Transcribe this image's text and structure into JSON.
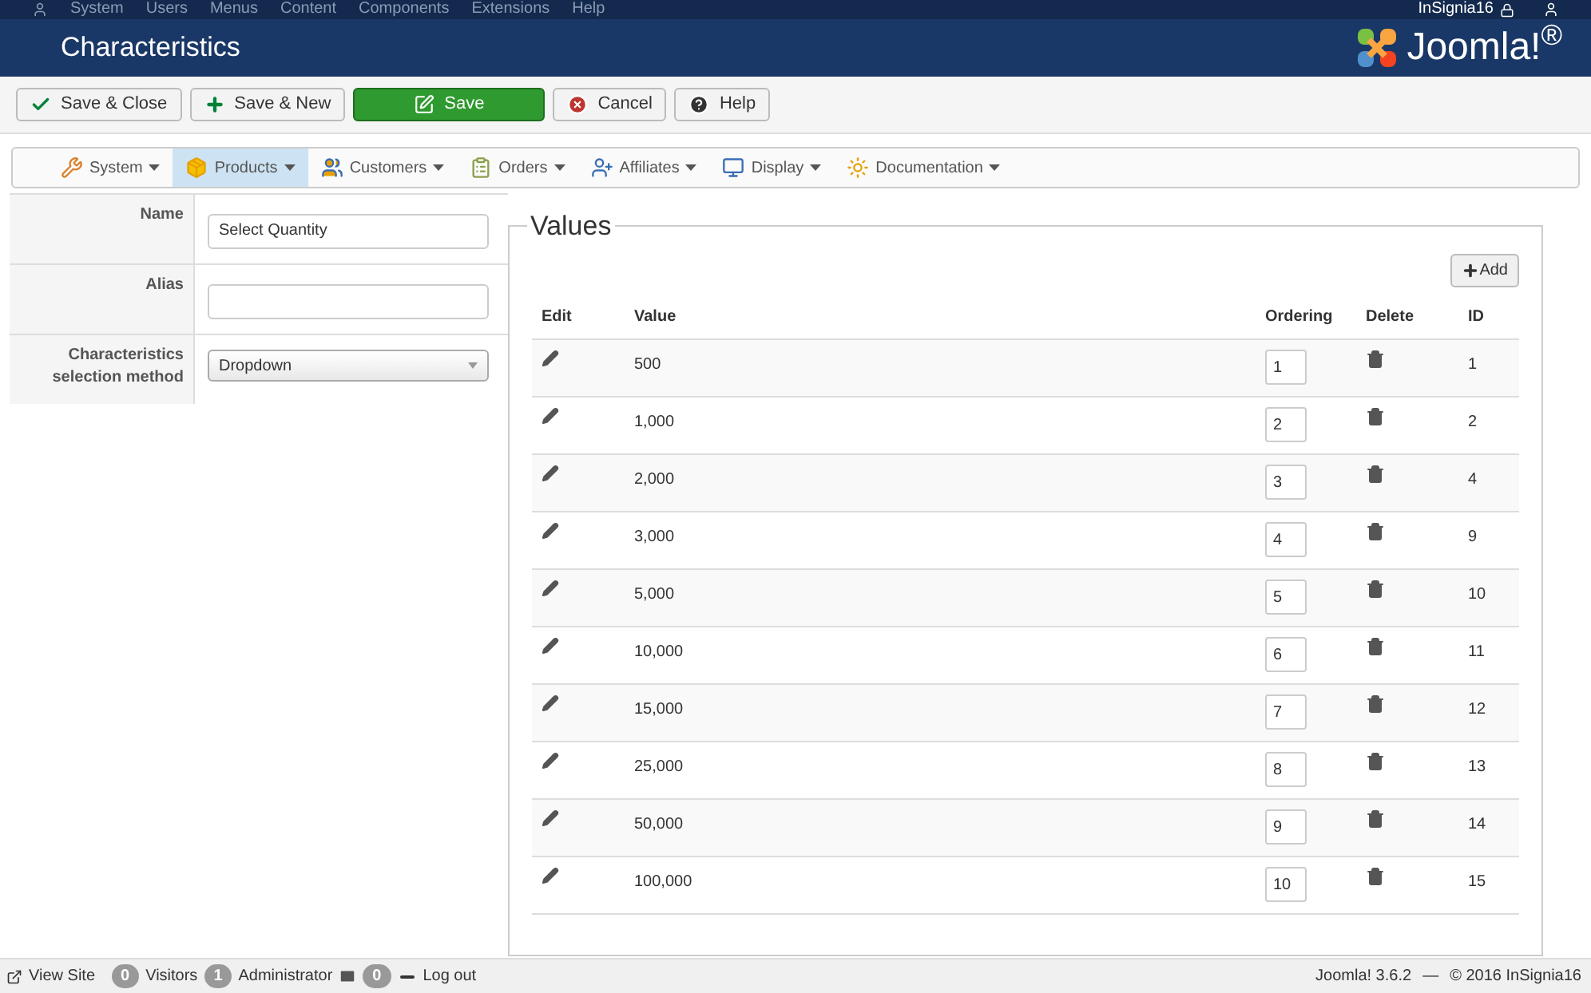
{
  "top_menu": {
    "items": [
      "System",
      "Users",
      "Menus",
      "Content",
      "Components",
      "Extensions",
      "Help"
    ],
    "user": "InSignia16"
  },
  "header": {
    "title": "Characteristics",
    "logo": "Joomla!$^{®}$"
  },
  "toolbar": [
    {
      "label": "Save & Close",
      "kind": "check"
    },
    {
      "label": "Save & New",
      "kind": "new"
    },
    {
      "label": "Save",
      "kind": "primary"
    },
    {
      "label": "Cancel",
      "kind": "cancel"
    },
    {
      "label": "Help",
      "kind": "help"
    }
  ],
  "submenu": [
    {
      "label": "System",
      "kind": "tools",
      "selected": false
    },
    {
      "label": "Products",
      "kind": "box",
      "selected": true
    },
    {
      "label": "Customers",
      "kind": "users",
      "selected": false
    },
    {
      "label": "Orders",
      "kind": "orders",
      "selected": false
    },
    {
      "label": "Affiliates",
      "kind": "affiliates",
      "selected": false
    },
    {
      "label": "Display",
      "kind": "display",
      "selected": false
    },
    {
      "label": "Documentation",
      "kind": "docs",
      "selected": false
    }
  ],
  "form": [
    {
      "label": "Name",
      "kind": "text",
      "value": "Select Quantity"
    },
    {
      "label": "Alias",
      "kind": "text"
    },
    {
      "label": "Characteristics selection method",
      "kind": "select",
      "value": "Dropdown"
    }
  ],
  "values": {
    "legend": "Values",
    "add_button": "Add",
    "columns": [
      "Edit",
      "Value",
      "Ordering",
      "Delete",
      "ID"
    ],
    "rows": [
      {
        "value": "500",
        "ordering": "1",
        "id": "1"
      },
      {
        "value": "1,000",
        "ordering": "2",
        "id": "2"
      },
      {
        "value": "2,000",
        "ordering": "3",
        "id": "4"
      },
      {
        "value": "3,000",
        "ordering": "4",
        "id": "9"
      },
      {
        "value": "5,000",
        "ordering": "5",
        "id": "10"
      },
      {
        "value": "10,000",
        "ordering": "6",
        "id": "11"
      },
      {
        "value": "15,000",
        "ordering": "7",
        "id": "12"
      },
      {
        "value": "25,000",
        "ordering": "8",
        "id": "13"
      },
      {
        "value": "50,000",
        "ordering": "9",
        "id": "14"
      },
      {
        "value": "100,000",
        "ordering": "10",
        "id": "15"
      }
    ]
  },
  "status_bar": {
    "view_site": "View Site",
    "visitors_count": "0",
    "visitors": "Visitors",
    "admins_count": "1",
    "admins": "Administrator",
    "messages_count": "0",
    "logout": "Log out",
    "version": "Joomla! 3.6.2",
    "separator": "—",
    "copyright": "© 2016 InSignia16"
  }
}
